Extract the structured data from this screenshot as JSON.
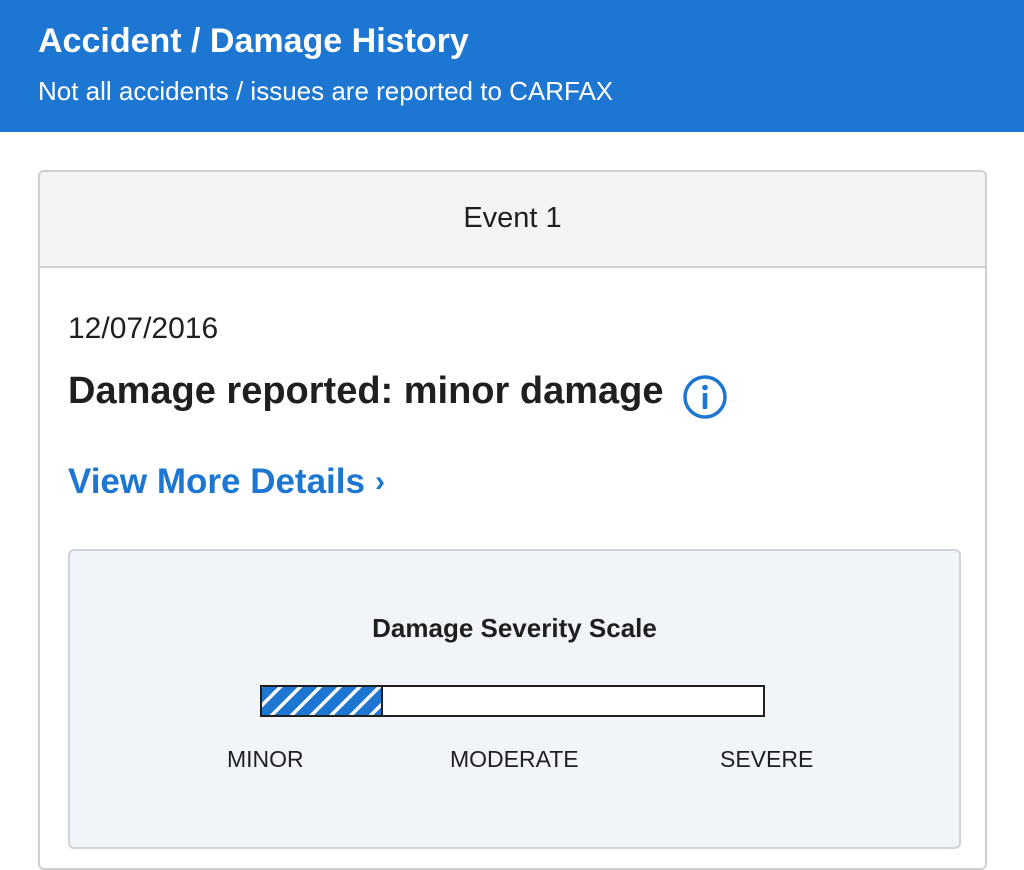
{
  "header": {
    "title": "Accident / Damage History",
    "subtitle": "Not all accidents / issues are reported to CARFAX",
    "background_color": "#1d76d2"
  },
  "event": {
    "title": "Event 1",
    "date": "12/07/2016",
    "damage_text": "Damage reported: minor damage",
    "info_icon": "info-circle-icon",
    "details_link": "View More Details",
    "details_chevron": "›"
  },
  "severity_scale": {
    "title": "Damage Severity Scale",
    "level": "minor",
    "fill_fraction": 0.24,
    "fill_color": "#1d76d2",
    "labels": {
      "minor": "MINOR",
      "moderate": "MODERATE",
      "severe": "SEVERE"
    }
  },
  "colors": {
    "accent": "#1d76d2",
    "text": "#1f1f1f",
    "scale_background": "#f1f5f9"
  }
}
